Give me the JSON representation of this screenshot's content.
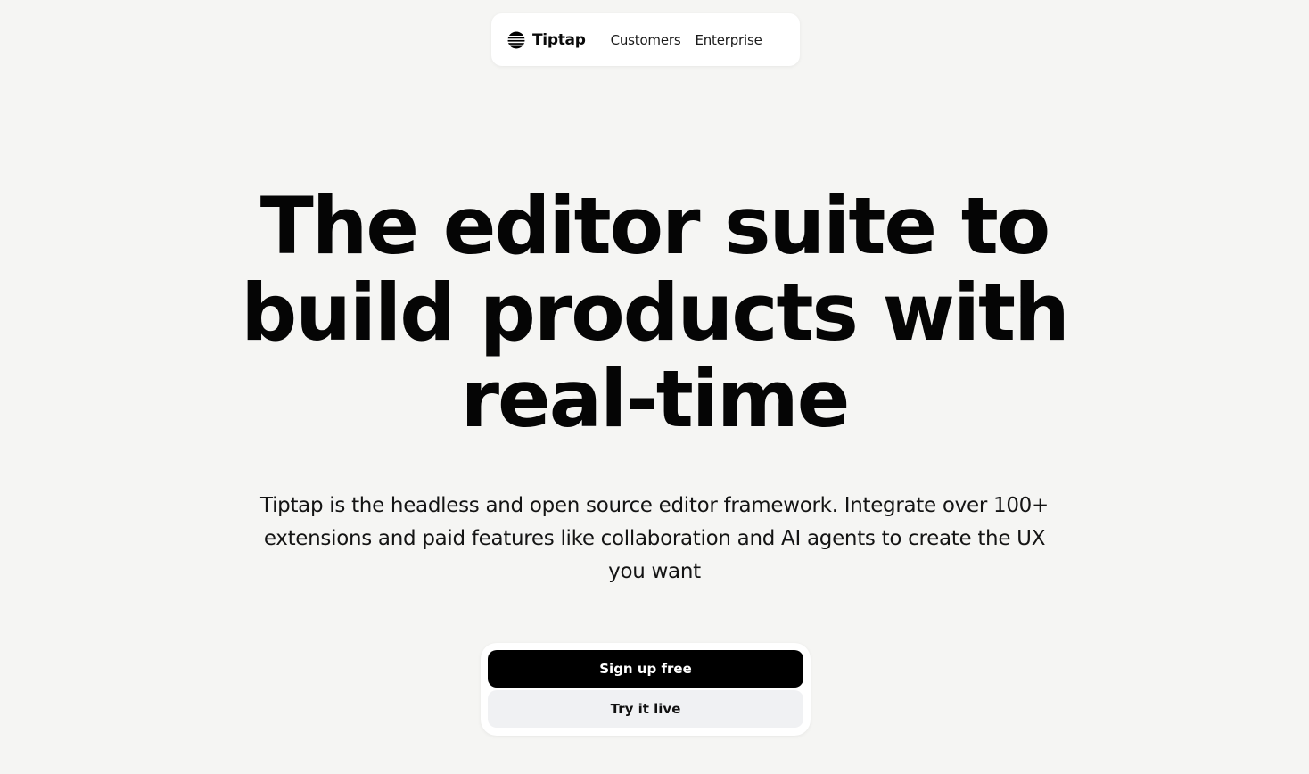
{
  "nav": {
    "brand": "Tiptap",
    "brand_icon": "tiptap-logo-icon",
    "links": [
      "Customers",
      "Enterprise"
    ]
  },
  "hero": {
    "title": "The editor suite to build products with real-time",
    "subtitle": "Tiptap is the headless and open source editor framework. Integrate over 100+ extensions and paid features like collaboration and AI agents to create the UX you want"
  },
  "cta": {
    "primary_label": "Sign up free",
    "secondary_label": "Try it live"
  },
  "colors": {
    "background": "#f5f5f3",
    "primary_button": "#000000",
    "secondary_button": "#f0f1f3",
    "text": "#0a0a0a"
  }
}
